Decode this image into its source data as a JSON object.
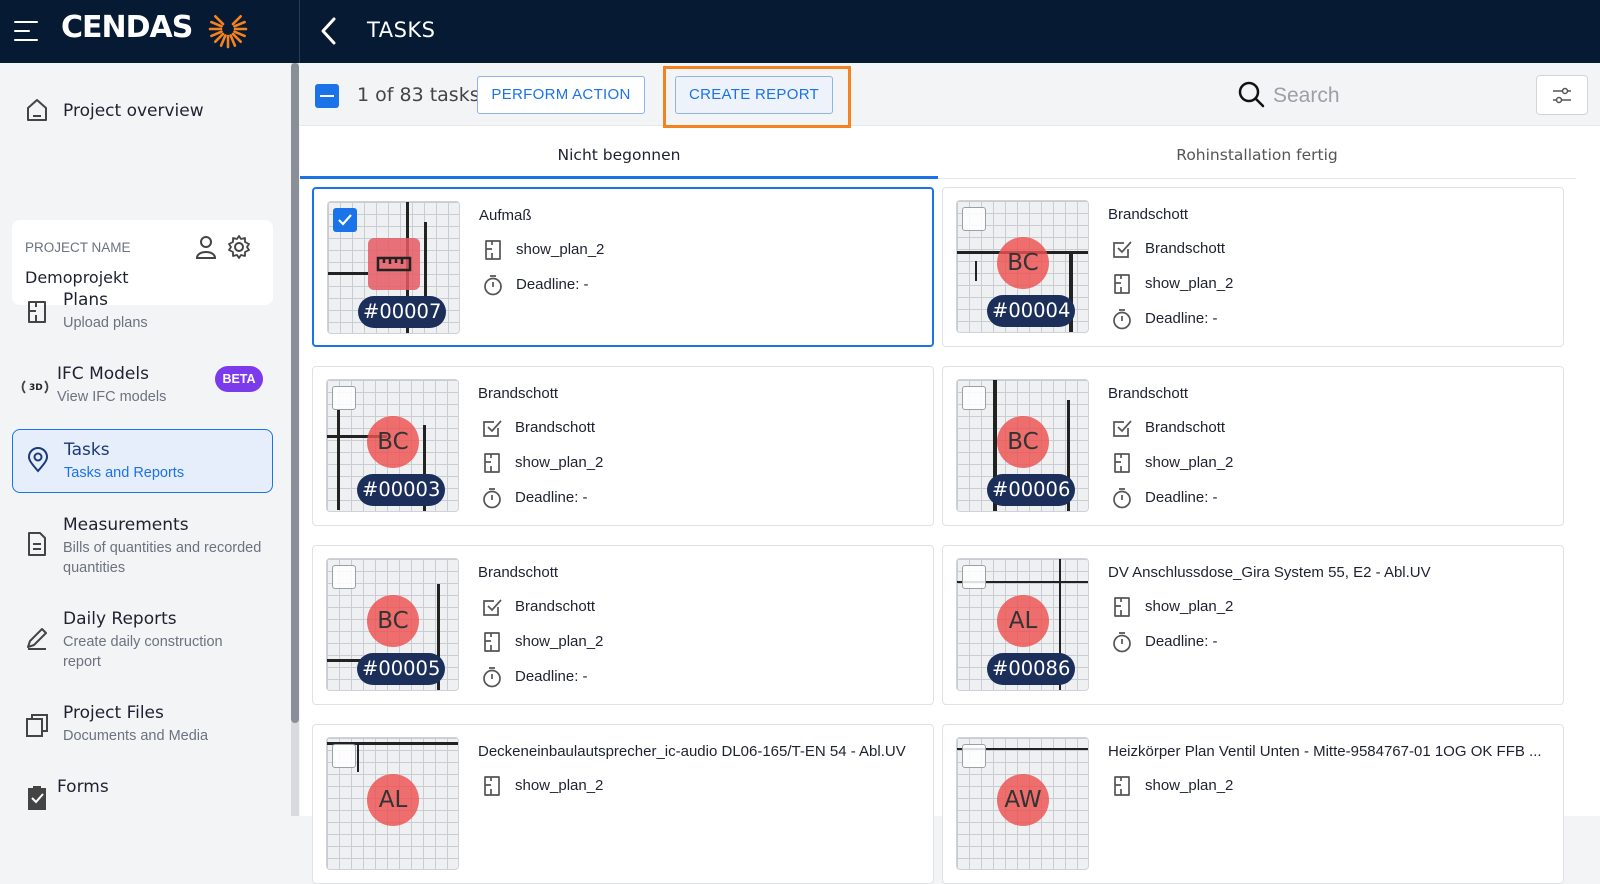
{
  "header": {
    "brand": "CENDAS",
    "title": "TASKS"
  },
  "sidebar": {
    "project_overview": "Project overview",
    "project_name_label": "PROJECT NAME",
    "project_name": "Demoprojekt",
    "items": [
      {
        "label": "Plans",
        "sub": "Upload plans"
      },
      {
        "label": "IFC Models",
        "sub": "View IFC models",
        "badge": "BETA"
      },
      {
        "label": "Tasks",
        "sub": "Tasks and Reports"
      },
      {
        "label": "Measurements",
        "sub": "Bills of quantities and recorded quantities"
      },
      {
        "label": "Daily Reports",
        "sub": "Create daily construction report"
      },
      {
        "label": "Project Files",
        "sub": "Documents and Media"
      },
      {
        "label": "Forms",
        "sub": ""
      }
    ]
  },
  "toolbar": {
    "count": "1 of 83 tasks",
    "perform_action": "PERFORM ACTION",
    "create_report": "CREATE REPORT",
    "search_placeholder": "Search"
  },
  "tabs": [
    "Nicht begonnen",
    "Rohinstallation fertig"
  ],
  "cards": [
    {
      "title": "Aufmaß",
      "number": "#00007",
      "badge": "",
      "type": "",
      "plan": "show_plan_2",
      "deadline": "Deadline: -"
    },
    {
      "title": "Brandschott",
      "number": "#00004",
      "badge": "BC",
      "type": "Brandschott",
      "plan": "show_plan_2",
      "deadline": "Deadline: -"
    },
    {
      "title": "Brandschott",
      "number": "#00003",
      "badge": "BC",
      "type": "Brandschott",
      "plan": "show_plan_2",
      "deadline": "Deadline: -"
    },
    {
      "title": "Brandschott",
      "number": "#00006",
      "badge": "BC",
      "type": "Brandschott",
      "plan": "show_plan_2",
      "deadline": "Deadline: -"
    },
    {
      "title": "Brandschott",
      "number": "#00005",
      "badge": "BC",
      "type": "Brandschott",
      "plan": "show_plan_2",
      "deadline": "Deadline: -"
    },
    {
      "title": "DV Anschlussdose_Gira System 55, E2 - Abl.UV",
      "number": "#00086",
      "badge": "AL",
      "type": "",
      "plan": "show_plan_2",
      "deadline": "Deadline: -"
    },
    {
      "title": "Deckeneinbaulautsprecher_ic-audio DL06-165/T-EN 54 - Abl.UV",
      "number": "",
      "badge": "AL",
      "type": "",
      "plan": "show_plan_2",
      "deadline": ""
    },
    {
      "title": "Heizkörper Plan Ventil Unten - Mitte-9584767-01 1OG OK FFB ...",
      "number": "",
      "badge": "AW",
      "type": "",
      "plan": "show_plan_2",
      "deadline": ""
    }
  ],
  "colors": {
    "topbar": "#071a33",
    "accent": "#1a73e8",
    "highlight": "#f58220",
    "beta": "#7c3aed",
    "badge_bg": "#1b2f5a"
  }
}
